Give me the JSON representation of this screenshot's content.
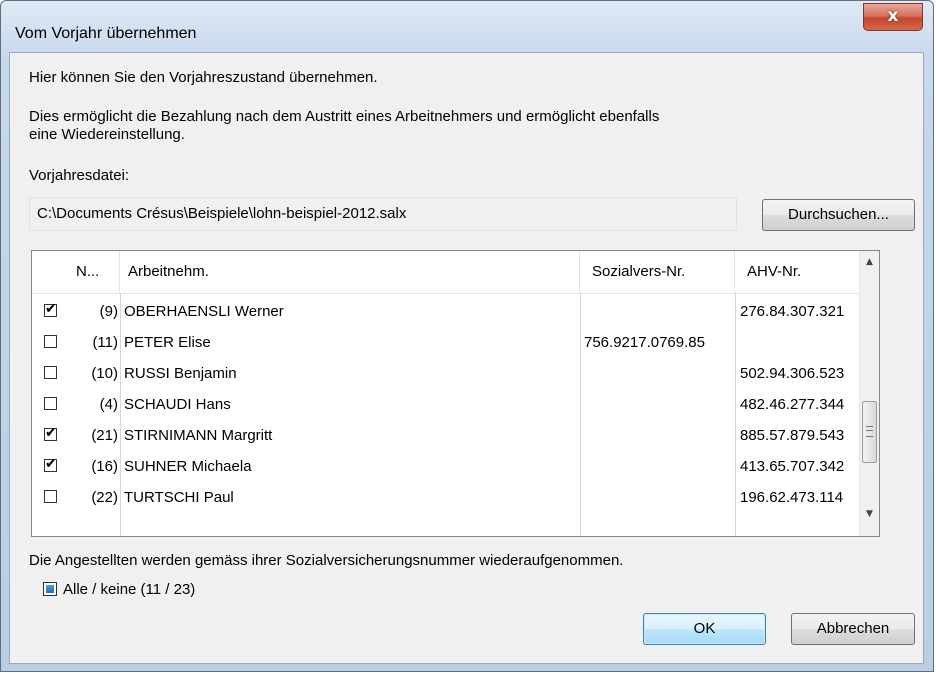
{
  "window": {
    "title": "Vom Vorjahr übernehmen",
    "close_label": "x"
  },
  "intro": {
    "line1": "Hier können Sie den Vorjahreszustand übernehmen.",
    "line2": "Dies ermöglicht die Bezahlung nach dem Austritt eines Arbeitnehmers und ermöglicht ebenfalls",
    "line3": "eine Wiedereinstellung."
  },
  "file": {
    "label": "Vorjahresdatei:",
    "path": "C:\\Documents Crésus\\Beispiele\\lohn-beispiel-2012.salx",
    "browse_label": "Durchsuchen..."
  },
  "list": {
    "columns": [
      "N...",
      "Arbeitnehm.",
      "Sozialvers-Nr.",
      "AHV-Nr."
    ],
    "rows": [
      {
        "checked": true,
        "num": "(9)",
        "name": "OBERHAENSLI Werner",
        "soz": "",
        "ahv": "276.84.307.321"
      },
      {
        "checked": false,
        "num": "(11)",
        "name": "PETER Elise",
        "soz": "756.9217.0769.85",
        "ahv": ""
      },
      {
        "checked": false,
        "num": "(10)",
        "name": "RUSSI Benjamin",
        "soz": "",
        "ahv": "502.94.306.523"
      },
      {
        "checked": false,
        "num": "(4)",
        "name": "SCHAUDI Hans",
        "soz": "",
        "ahv": "482.46.277.344"
      },
      {
        "checked": true,
        "num": "(21)",
        "name": "STIRNIMANN Margritt",
        "soz": "",
        "ahv": "885.57.879.543"
      },
      {
        "checked": true,
        "num": "(16)",
        "name": "SUHNER Michaela",
        "soz": "",
        "ahv": "413.65.707.342"
      },
      {
        "checked": false,
        "num": "(22)",
        "name": "TURTSCHI Paul",
        "soz": "",
        "ahv": "196.62.473.114"
      }
    ],
    "scroll_up_glyph": "▲",
    "scroll_down_glyph": "▼"
  },
  "footer": {
    "info": "Die Angestellten werden gemäss ihrer Sozialversicherungsnummer wiederaufgenommen.",
    "all_label": "Alle / keine (11 / 23)",
    "ok_label": "OK",
    "cancel_label": "Abbrechen"
  },
  "colors": {
    "accent": "#3c7fb1",
    "close": "#c4462d",
    "dialog_bg": "#f0f0f0"
  }
}
